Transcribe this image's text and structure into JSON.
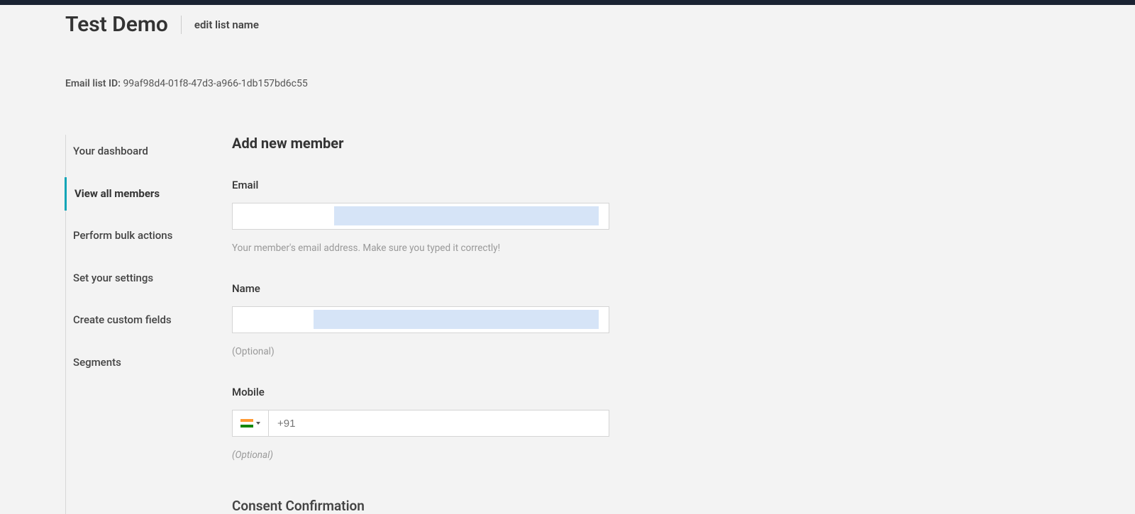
{
  "header": {
    "title": "Test Demo",
    "edit_link": "edit list name"
  },
  "list_id": {
    "label": "Email list ID: ",
    "value": "99af98d4-01f8-47d3-a966-1db157bd6c55"
  },
  "sidebar": {
    "items": [
      {
        "label": "Your dashboard",
        "active": false
      },
      {
        "label": "View all members",
        "active": true
      },
      {
        "label": "Perform bulk actions",
        "active": false
      },
      {
        "label": "Set your settings",
        "active": false
      },
      {
        "label": "Create custom fields",
        "active": false
      },
      {
        "label": "Segments",
        "active": false
      }
    ]
  },
  "form": {
    "title": "Add new member",
    "email": {
      "label": "Email",
      "value": "",
      "helper": "Your member's email address. Make sure you typed it correctly!"
    },
    "name": {
      "label": "Name",
      "value": "",
      "helper": "(Optional)"
    },
    "mobile": {
      "label": "Mobile",
      "placeholder": "+91",
      "helper": "(Optional)",
      "country_code": "IN"
    },
    "consent": {
      "title": "Consent Confirmation"
    }
  }
}
